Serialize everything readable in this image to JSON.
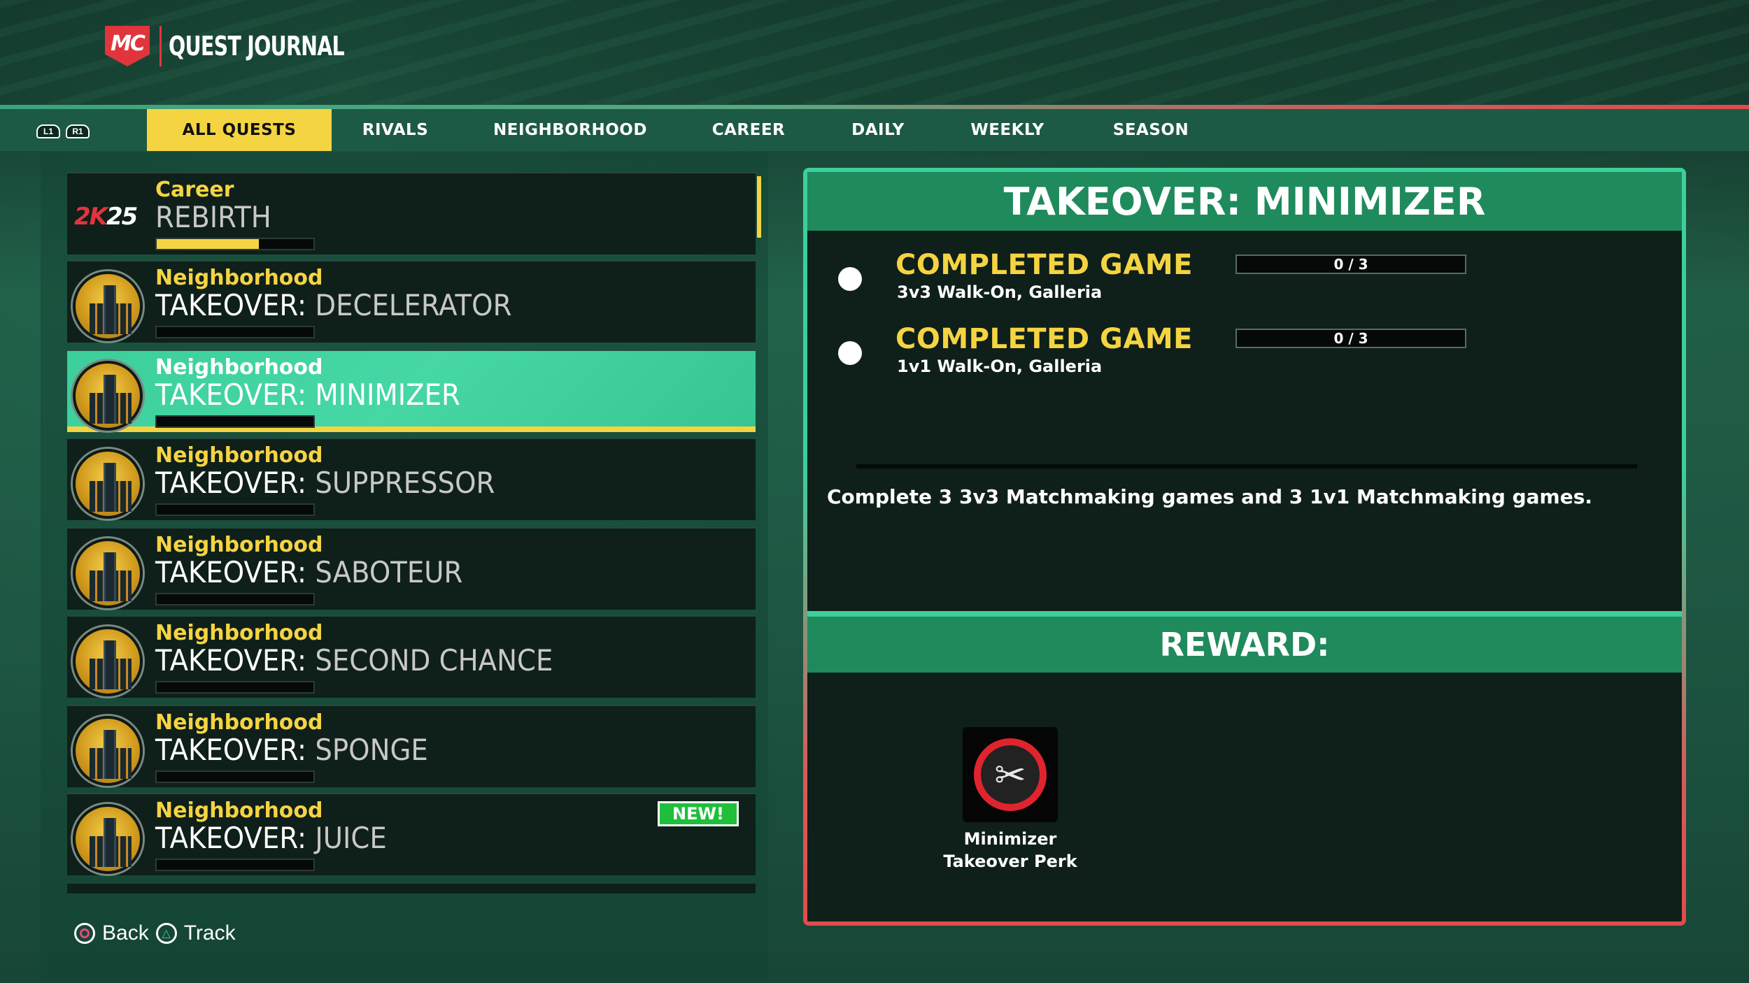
{
  "header": {
    "logo_text": "MC",
    "title": "QUEST JOURNAL"
  },
  "bumpers": {
    "left": "L1",
    "right": "R1"
  },
  "tabs": [
    {
      "label": "ALL QUESTS",
      "active": true
    },
    {
      "label": "RIVALS"
    },
    {
      "label": "NEIGHBORHOOD"
    },
    {
      "label": "CAREER"
    },
    {
      "label": "DAILY"
    },
    {
      "label": "WEEKLY"
    },
    {
      "label": "SEASON"
    }
  ],
  "quests": [
    {
      "category": "Career",
      "prefix": "",
      "name": "REBIRTH",
      "progress": 0.65,
      "icon": "2k25-logo"
    },
    {
      "category": "Neighborhood",
      "prefix": "TAKEOVER:",
      "name": " DECELERATOR",
      "progress": 0,
      "icon": "city-tower-icon"
    },
    {
      "category": "Neighborhood",
      "prefix": "TAKEOVER:",
      "name": " MINIMIZER",
      "progress": 0,
      "icon": "city-tower-icon",
      "selected": true
    },
    {
      "category": "Neighborhood",
      "prefix": "TAKEOVER:",
      "name": " SUPPRESSOR",
      "progress": 0,
      "icon": "city-tower-icon"
    },
    {
      "category": "Neighborhood",
      "prefix": "TAKEOVER:",
      "name": " SABOTEUR",
      "progress": 0,
      "icon": "city-tower-icon"
    },
    {
      "category": "Neighborhood",
      "prefix": "TAKEOVER:",
      "name": " SECOND CHANCE",
      "progress": 0,
      "icon": "city-tower-icon"
    },
    {
      "category": "Neighborhood",
      "prefix": "TAKEOVER:",
      "name": " SPONGE",
      "progress": 0,
      "icon": "city-tower-icon"
    },
    {
      "category": "Neighborhood",
      "prefix": "TAKEOVER:",
      "name": " JUICE",
      "progress": 0,
      "icon": "city-tower-icon",
      "badge": "NEW!"
    }
  ],
  "logo_2k": {
    "k": "2K",
    "n": "25"
  },
  "footer": {
    "back_label": "Back",
    "track_label": "Track"
  },
  "detail": {
    "title": "TAKEOVER: MINIMIZER",
    "objectives": [
      {
        "title": "COMPLETED GAME",
        "subtitle": "3v3 Walk-On, Galleria",
        "progress": "0 / 3"
      },
      {
        "title": "COMPLETED GAME",
        "subtitle": "1v1 Walk-On, Galleria",
        "progress": "0 / 3"
      }
    ],
    "description": "Complete 3 3v3 Matchmaking games and 3 1v1 Matchmaking games.",
    "reward_heading": "REWARD:",
    "reward": {
      "label": "Minimizer Takeover Perk",
      "icon": "scissors-icon"
    }
  },
  "colors": {
    "accent_yellow": "#f5d442",
    "accent_green": "#3ccf9b",
    "header_green": "#1f8a5c",
    "accent_red": "#e04b4b"
  }
}
